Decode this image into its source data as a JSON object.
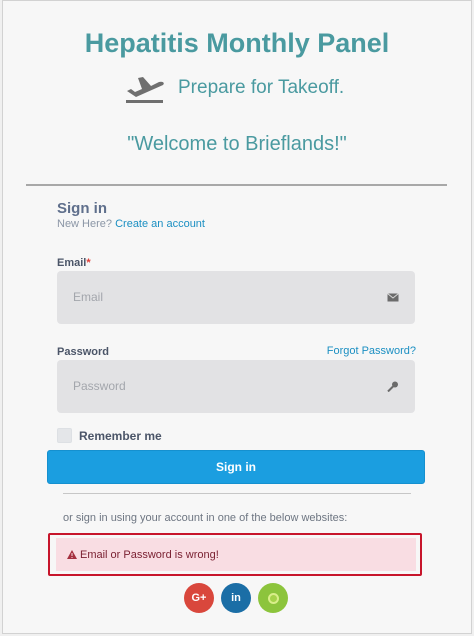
{
  "header": {
    "title": "Hepatitis Monthly Panel",
    "tagline": "Prepare for Takeoff.",
    "welcome": "\"Welcome to Brieflands!\""
  },
  "signin": {
    "heading": "Sign in",
    "new_here": "New Here?",
    "create_account": "Create an account"
  },
  "email": {
    "label": "Email",
    "required_mark": "*",
    "placeholder": "Email",
    "icon": "envelope-icon"
  },
  "password": {
    "label": "Password",
    "forgot": "Forgot Password?",
    "placeholder": "Password",
    "icon": "key-icon"
  },
  "remember": {
    "label": "Remember me",
    "checked": false
  },
  "buttons": {
    "signin_label": "Sign in"
  },
  "alt_signin": {
    "text": "or sign in using your account in one of the below websites:"
  },
  "error": {
    "message": "Email or Password is wrong!",
    "icon": "warning-icon"
  },
  "social": [
    {
      "label": "G+",
      "icon": "google-plus-icon",
      "color": "#d9473c"
    },
    {
      "label": "in",
      "icon": "linkedin-icon",
      "color": "#1b6ea6"
    },
    {
      "label": "",
      "icon": "orcid-icon",
      "color": "#8cc43c"
    }
  ],
  "colors": {
    "brand_teal": "#4a9aa0",
    "primary_button": "#1b9ee0",
    "link": "#1b8fc2",
    "error_border": "#c7152b",
    "error_background": "#f9dde3"
  }
}
